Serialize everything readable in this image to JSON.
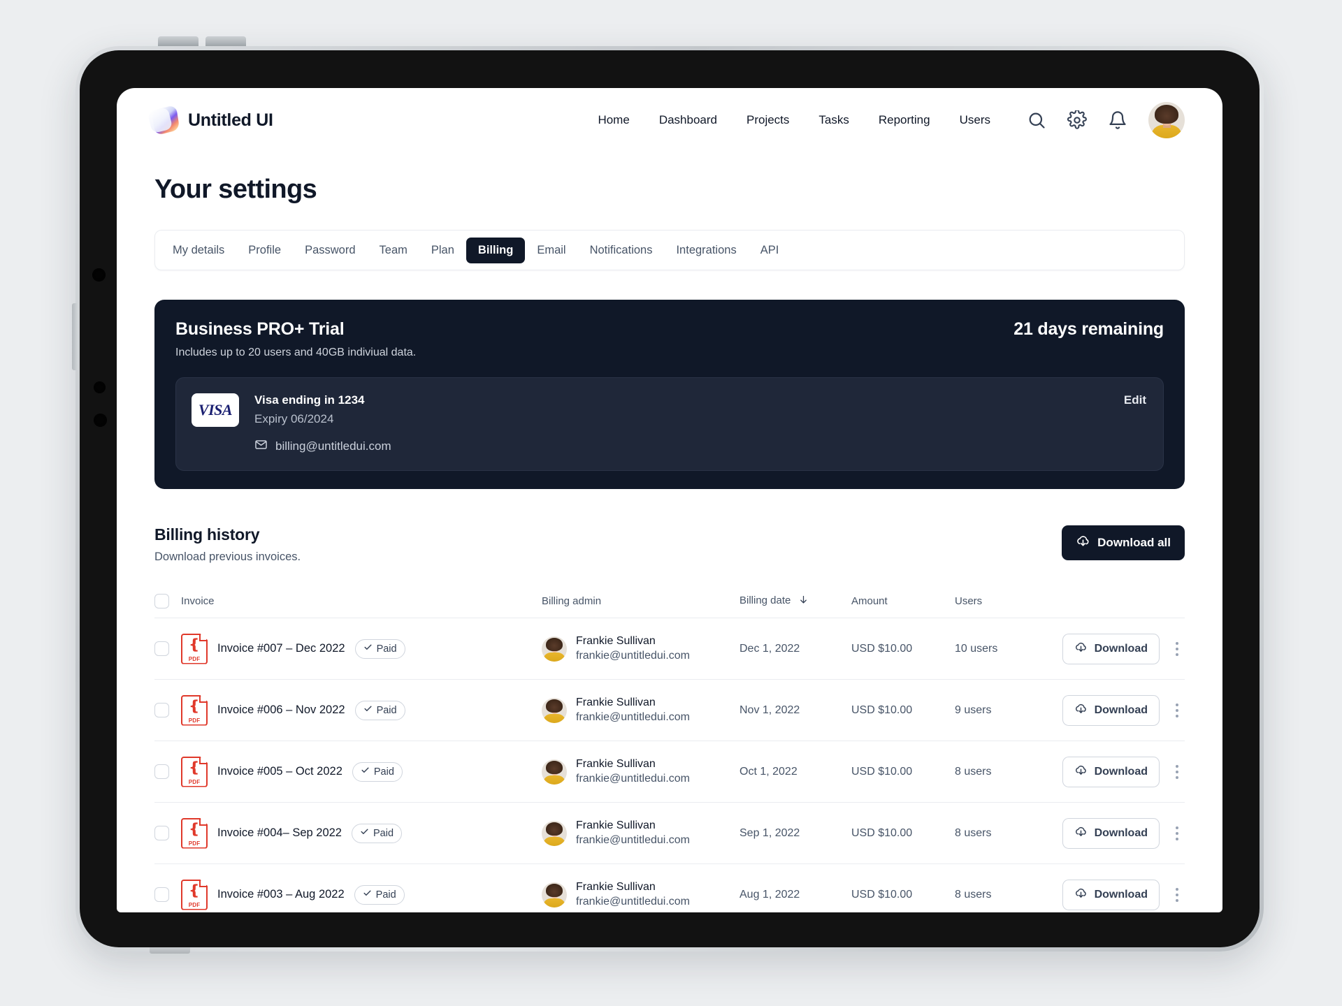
{
  "brand": {
    "name": "Untitled UI",
    "logo_icon": "gradient-square-logo"
  },
  "nav": {
    "links": [
      "Home",
      "Dashboard",
      "Projects",
      "Tasks",
      "Reporting",
      "Users"
    ],
    "icons": [
      "search-icon",
      "gear-icon",
      "bell-icon"
    ],
    "avatar_alt": "user-avatar"
  },
  "page": {
    "title": "Your settings"
  },
  "tabs": {
    "items": [
      {
        "label": "My details",
        "active": false
      },
      {
        "label": "Profile",
        "active": false
      },
      {
        "label": "Password",
        "active": false
      },
      {
        "label": "Team",
        "active": false
      },
      {
        "label": "Plan",
        "active": false
      },
      {
        "label": "Billing",
        "active": true
      },
      {
        "label": "Email",
        "active": false
      },
      {
        "label": "Notifications",
        "active": false
      },
      {
        "label": "Integrations",
        "active": false
      },
      {
        "label": "API",
        "active": false
      }
    ]
  },
  "trial": {
    "title": "Business PRO+ Trial",
    "subtitle": "Includes up to 20 users and 40GB indiviual data.",
    "days_remaining": "21 days remaining",
    "card": {
      "brand_logo_text": "VISA",
      "name": "Visa ending in 1234",
      "expiry": "Expiry 06/2024",
      "email": "billing@untitledui.com",
      "email_icon": "mail-icon",
      "edit_label": "Edit"
    },
    "bg_color": "#101828",
    "card_bg_color": "#1f2739"
  },
  "billing_history": {
    "title": "Billing history",
    "subtitle": "Download previous invoices.",
    "download_all_label": "Download all",
    "download_all_icon": "cloud-download-icon",
    "columns": [
      "Invoice",
      "Billing admin",
      "Billing date",
      "Amount",
      "Users"
    ],
    "sort_column": "Billing date",
    "sort_direction": "desc",
    "sort_icon": "arrow-down-icon",
    "row_action_label": "Download",
    "row_action_icon": "cloud-download-icon",
    "row_menu_icon": "kebab-menu-icon",
    "status_icon": "check-icon",
    "file_icon": "pdf-file-icon",
    "rows": [
      {
        "invoice": "Invoice #007 – Dec 2022",
        "status": "Paid",
        "admin_name": "Frankie Sullivan",
        "admin_email": "frankie@untitledui.com",
        "date": "Dec 1, 2022",
        "amount": "USD $10.00",
        "users": "10 users"
      },
      {
        "invoice": "Invoice #006 – Nov 2022",
        "status": "Paid",
        "admin_name": "Frankie Sullivan",
        "admin_email": "frankie@untitledui.com",
        "date": "Nov 1, 2022",
        "amount": "USD $10.00",
        "users": "9 users"
      },
      {
        "invoice": "Invoice #005 – Oct 2022",
        "status": "Paid",
        "admin_name": "Frankie Sullivan",
        "admin_email": "frankie@untitledui.com",
        "date": "Oct 1, 2022",
        "amount": "USD $10.00",
        "users": "8 users"
      },
      {
        "invoice": "Invoice #004– Sep 2022",
        "status": "Paid",
        "admin_name": "Frankie Sullivan",
        "admin_email": "frankie@untitledui.com",
        "date": "Sep 1, 2022",
        "amount": "USD $10.00",
        "users": "8 users"
      },
      {
        "invoice": "Invoice #003 – Aug 2022",
        "status": "Paid",
        "admin_name": "Frankie Sullivan",
        "admin_email": "frankie@untitledui.com",
        "date": "Aug 1, 2022",
        "amount": "USD $10.00",
        "users": "8 users"
      }
    ]
  }
}
